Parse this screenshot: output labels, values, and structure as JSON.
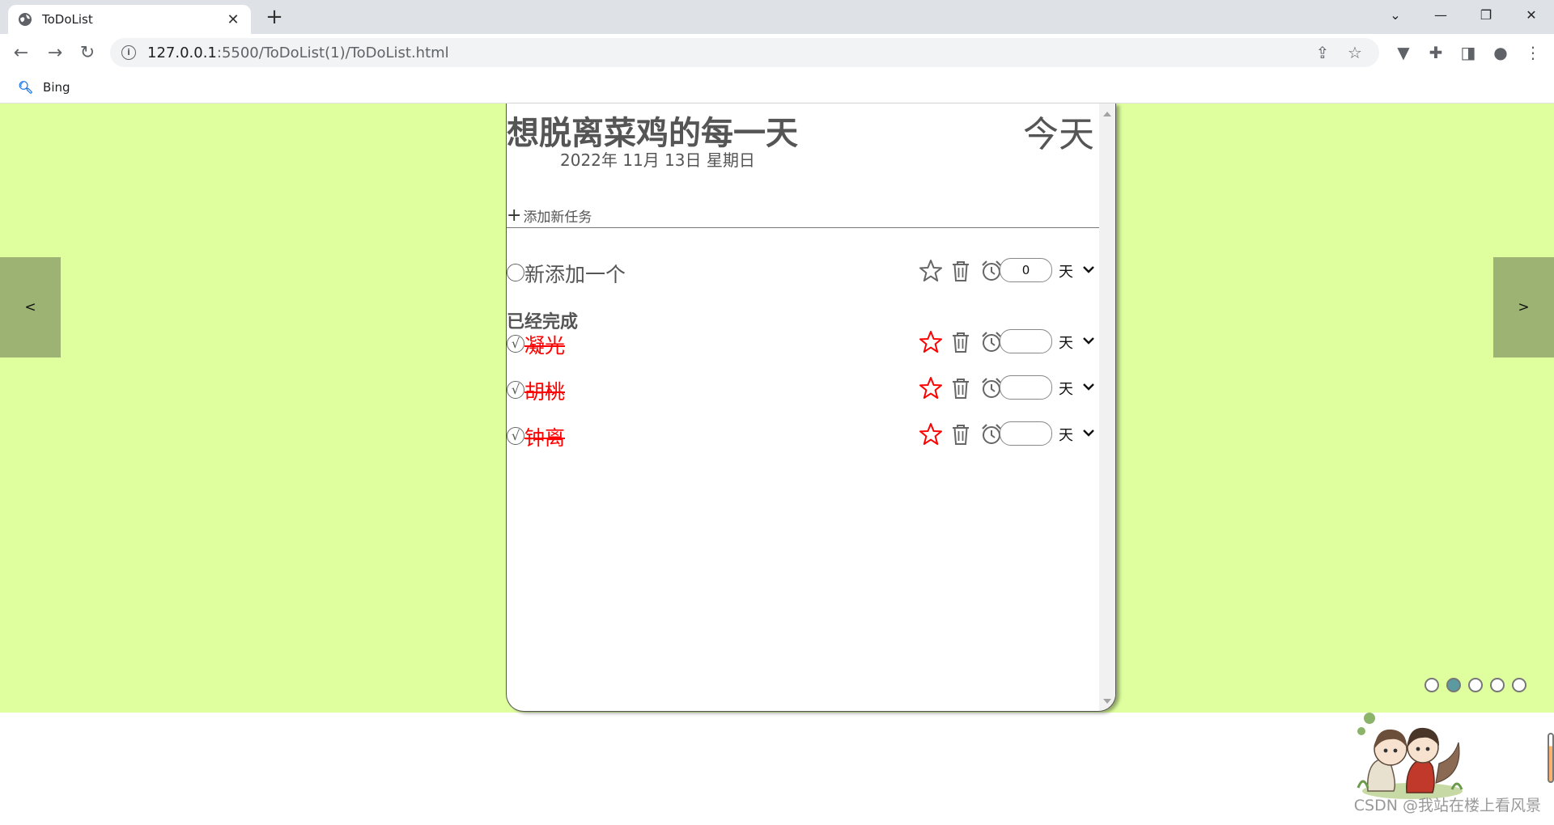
{
  "browser": {
    "tab_title": "ToDoList",
    "url_host": "127.0.0.1",
    "url_rest": ":5500/ToDoList(1)/ToDoList.html",
    "bookmark_label": "Bing"
  },
  "slider": {
    "prev_label": "<",
    "next_label": ">",
    "dot_count": 5,
    "active_dot": 2
  },
  "card": {
    "title": "想脱离菜鸡的每一天",
    "today_label": "今天",
    "date": "2022年 11月 13日 星期日",
    "add_task_label": "添加新任务",
    "add_task_icon": "+"
  },
  "pending": [
    {
      "name": "新添加一个",
      "days": "0",
      "starred": false
    }
  ],
  "completed_label": "已经完成",
  "completed": [
    {
      "name": "凝光",
      "days": "",
      "starred": true
    },
    {
      "name": "胡桃",
      "days": "",
      "starred": true
    },
    {
      "name": "钟离",
      "days": "",
      "starred": true
    }
  ],
  "days_unit": "天",
  "check_done_glyph": "√",
  "watermark": "CSDN @我站在楼上看风景",
  "colors": {
    "page_bg": "#dfff9f",
    "slide_btn": "#9cb373",
    "active_dot": "#5b9aa0",
    "done_text": "#ff0000",
    "text_gray": "#555555"
  }
}
